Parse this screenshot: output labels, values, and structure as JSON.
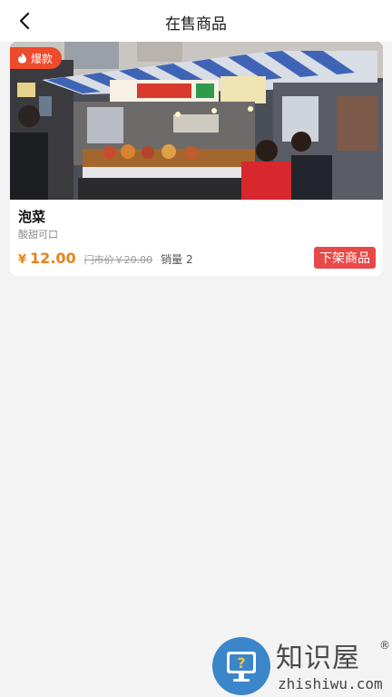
{
  "header": {
    "title": "在售商品"
  },
  "product": {
    "badge": "爆款",
    "name": "泡菜",
    "subtitle": "酸甜可口",
    "price_symbol": "¥",
    "price": "12.00",
    "original_price": "门市价￥20.00",
    "sales": "销量 2",
    "action_label": "下架商品"
  },
  "watermark": {
    "brand": "知识屋",
    "registered": "®",
    "domain": "zhishiwu.com"
  },
  "colors": {
    "accent_price": "#e8831b",
    "action_button": "#e94848",
    "badge": "#ee4a2c",
    "watermark_blue": "#3b86c9"
  },
  "icons": {
    "back": "chevron-left-icon",
    "badge": "flame-icon",
    "watermark": "monitor-question-icon"
  }
}
